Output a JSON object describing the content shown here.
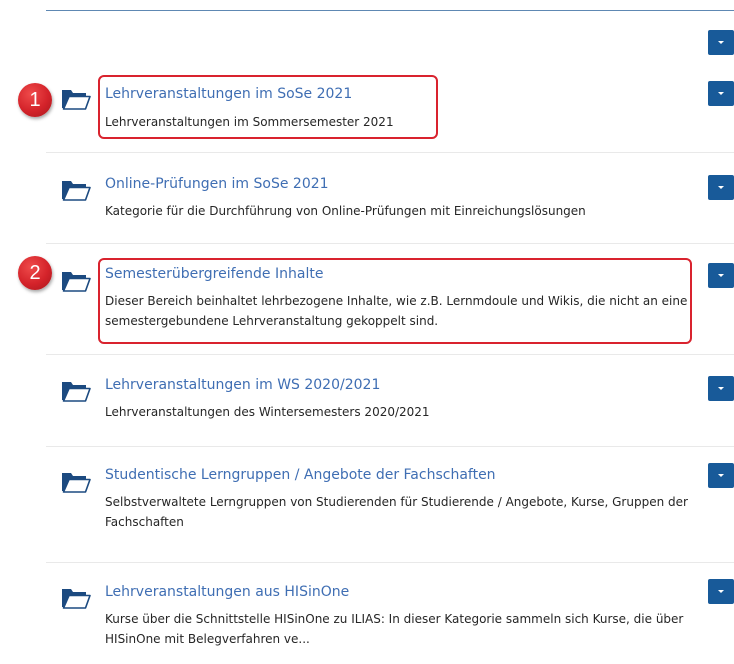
{
  "categories": [
    {
      "title": "Lehrveranstaltungen im SoSe 2021",
      "description": "Lehrveranstaltungen im Sommersemester 2021"
    },
    {
      "title": "Online-Prüfungen im SoSe 2021",
      "description": "Kategorie für die Durchführung von Online-Prüfungen mit Einreichungslösungen"
    },
    {
      "title": "Semesterübergreifende Inhalte",
      "description": "Dieser Bereich beinhaltet lehrbezogene Inhalte, wie z.B. Lernmdoule und Wikis, die nicht an eine semestergebundene Lehrveranstaltung gekoppelt sind."
    },
    {
      "title": "Lehrveranstaltungen im WS 2020/2021",
      "description": "Lehrveranstaltungen des Wintersemesters 2020/2021"
    },
    {
      "title": "Studentische Lerngruppen / Angebote der Fachschaften",
      "description": "Selbstverwaltete Lerngruppen von Studierenden für Studierende / Angebote, Kurse, Gruppen der Fachschaften"
    },
    {
      "title": "Lehrveranstaltungen aus HISinOne",
      "description": "Kurse über die Schnittstelle HISinOne zu ILIAS: In dieser Kategorie sammeln sich Kurse, die über HISinOne mit Belegverfahren ve..."
    }
  ],
  "annotations": [
    {
      "number": "1",
      "target": "Lehrveranstaltungen im SoSe 2021"
    },
    {
      "number": "2",
      "target": "Semesterübergreifende Inhalte"
    }
  ],
  "icons": {
    "item_icon": "folder-icon",
    "action_icon": "chevron-down-icon"
  },
  "colors": {
    "link": "#3f6eb3",
    "action_button": "#185a99",
    "annotation": "#d9232e"
  }
}
